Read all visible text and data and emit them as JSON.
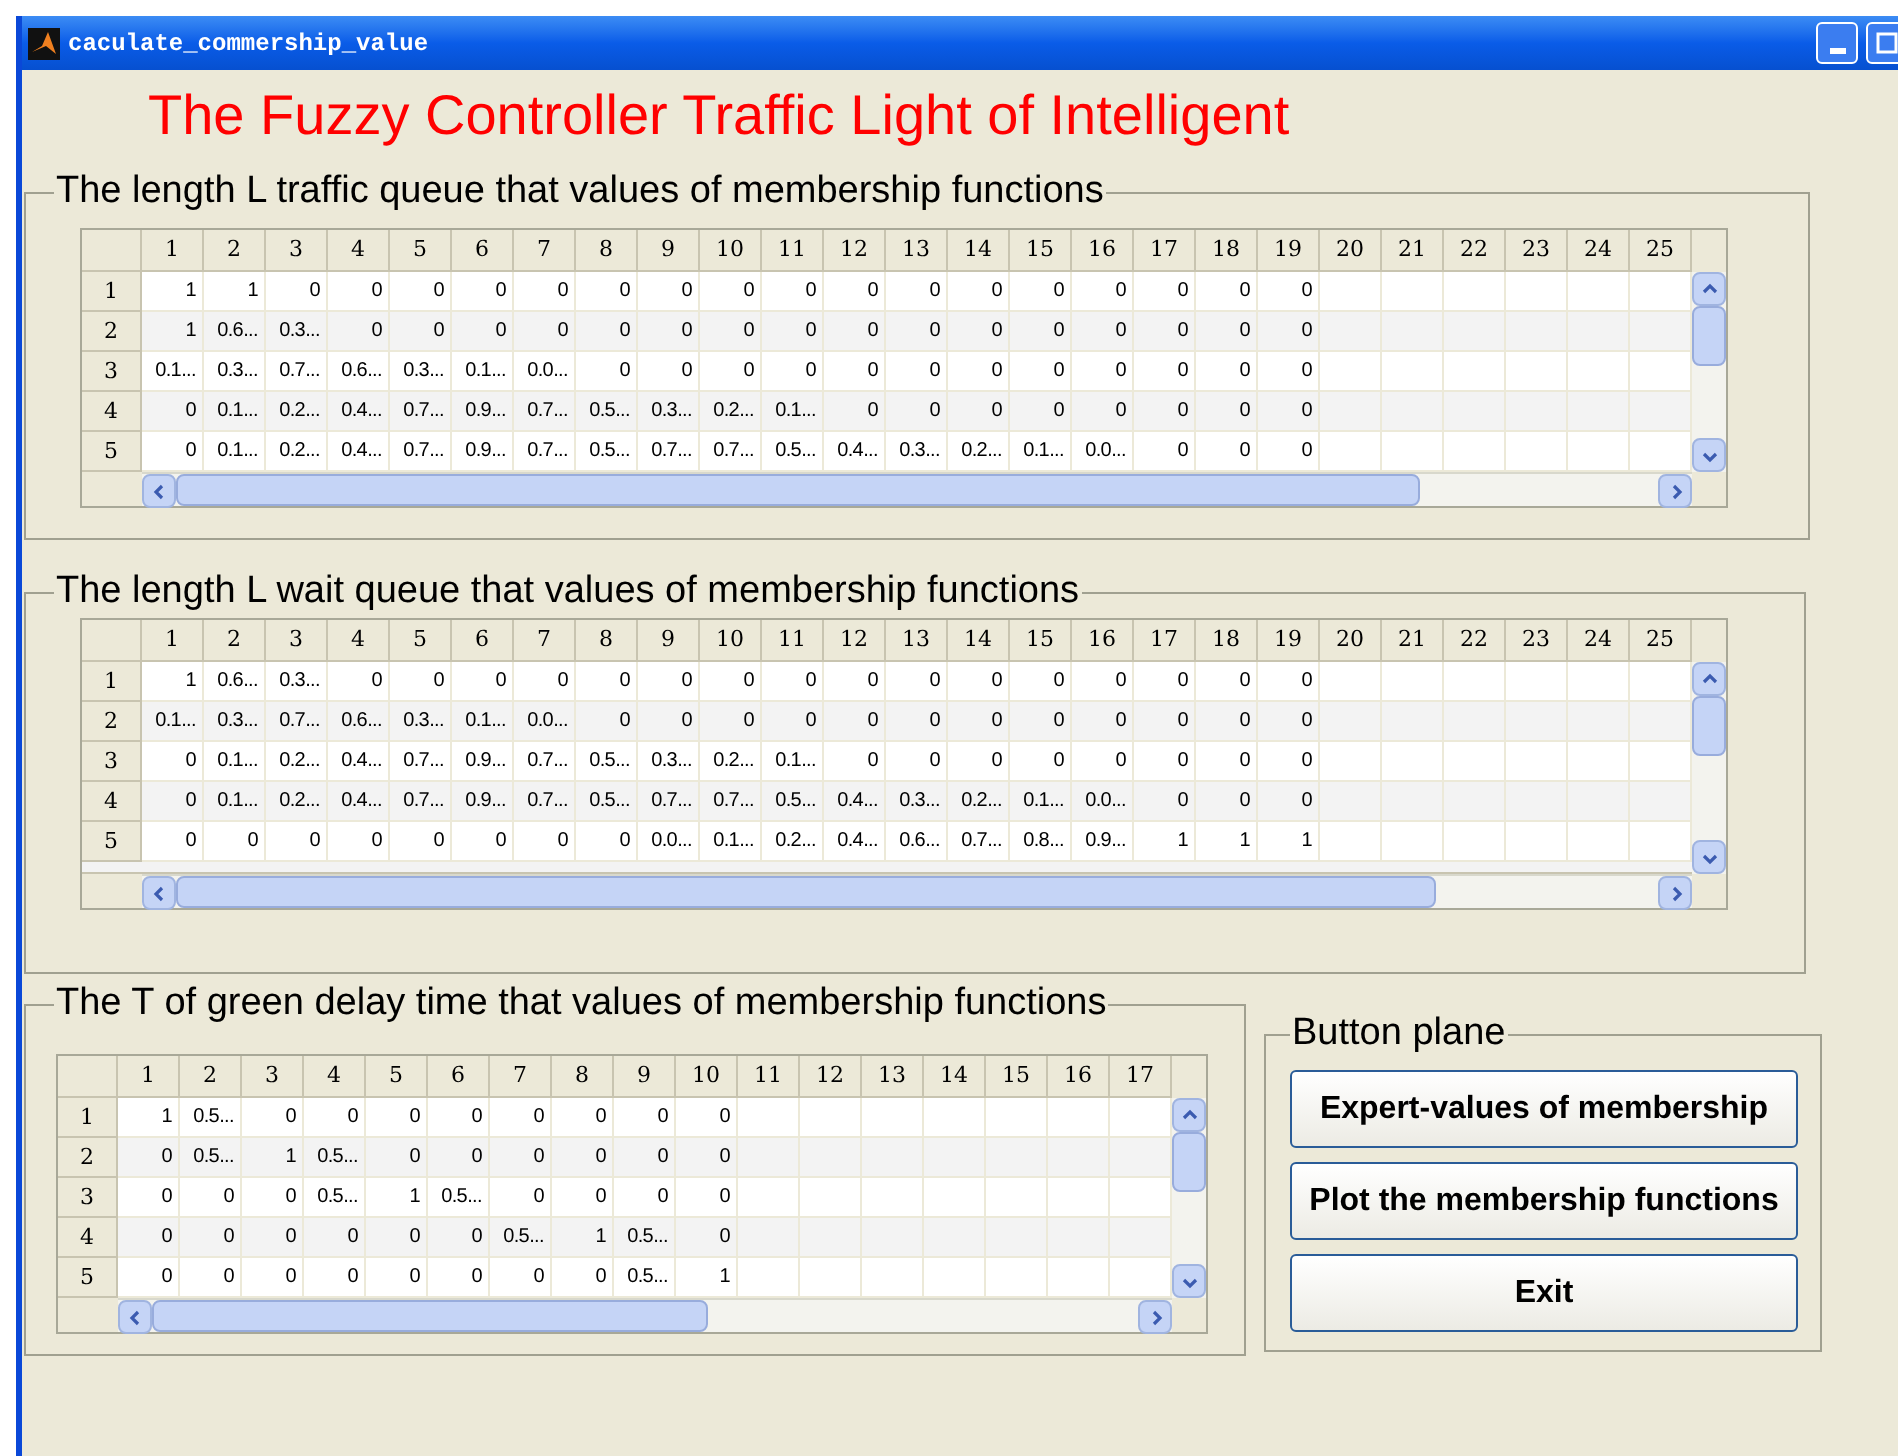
{
  "window": {
    "title": "caculate_commership_value"
  },
  "heading": "The Fuzzy Controller Traffic Light of Intelligent",
  "tables": [
    {
      "title": "The length L traffic queue that values of membership functions",
      "columns": [
        "1",
        "2",
        "3",
        "4",
        "5",
        "6",
        "7",
        "8",
        "9",
        "10",
        "11",
        "12",
        "13",
        "14",
        "15",
        "16",
        "17",
        "18",
        "19",
        "20",
        "21",
        "22",
        "23",
        "24",
        "25"
      ],
      "rows": [
        {
          "label": "1",
          "cells": [
            "1",
            "1",
            "0",
            "0",
            "0",
            "0",
            "0",
            "0",
            "0",
            "0",
            "0",
            "0",
            "0",
            "0",
            "0",
            "0",
            "0",
            "0",
            "0"
          ]
        },
        {
          "label": "2",
          "cells": [
            "1",
            "0.6...",
            "0.3...",
            "0",
            "0",
            "0",
            "0",
            "0",
            "0",
            "0",
            "0",
            "0",
            "0",
            "0",
            "0",
            "0",
            "0",
            "0",
            "0"
          ]
        },
        {
          "label": "3",
          "cells": [
            "0.1...",
            "0.3...",
            "0.7...",
            "0.6...",
            "0.3...",
            "0.1...",
            "0.0...",
            "0",
            "0",
            "0",
            "0",
            "0",
            "0",
            "0",
            "0",
            "0",
            "0",
            "0",
            "0"
          ]
        },
        {
          "label": "4",
          "cells": [
            "0",
            "0.1...",
            "0.2...",
            "0.4...",
            "0.7...",
            "0.9...",
            "0.7...",
            "0.5...",
            "0.3...",
            "0.2...",
            "0.1...",
            "0",
            "0",
            "0",
            "0",
            "0",
            "0",
            "0",
            "0"
          ]
        },
        {
          "label": "5",
          "cells": [
            "0",
            "0.1...",
            "0.2...",
            "0.4...",
            "0.7...",
            "0.9...",
            "0.7...",
            "0.5...",
            "0.7...",
            "0.7...",
            "0.5...",
            "0.4...",
            "0.3...",
            "0.2...",
            "0.1...",
            "0.0...",
            "0",
            "0",
            "0"
          ]
        }
      ]
    },
    {
      "title": "The length L wait queue that values of membership functions",
      "columns": [
        "1",
        "2",
        "3",
        "4",
        "5",
        "6",
        "7",
        "8",
        "9",
        "10",
        "11",
        "12",
        "13",
        "14",
        "15",
        "16",
        "17",
        "18",
        "19",
        "20",
        "21",
        "22",
        "23",
        "24",
        "25"
      ],
      "rows": [
        {
          "label": "1",
          "cells": [
            "1",
            "0.6...",
            "0.3...",
            "0",
            "0",
            "0",
            "0",
            "0",
            "0",
            "0",
            "0",
            "0",
            "0",
            "0",
            "0",
            "0",
            "0",
            "0",
            "0"
          ]
        },
        {
          "label": "2",
          "cells": [
            "0.1...",
            "0.3...",
            "0.7...",
            "0.6...",
            "0.3...",
            "0.1...",
            "0.0...",
            "0",
            "0",
            "0",
            "0",
            "0",
            "0",
            "0",
            "0",
            "0",
            "0",
            "0",
            "0"
          ]
        },
        {
          "label": "3",
          "cells": [
            "0",
            "0.1...",
            "0.2...",
            "0.4...",
            "0.7...",
            "0.9...",
            "0.7...",
            "0.5...",
            "0.3...",
            "0.2...",
            "0.1...",
            "0",
            "0",
            "0",
            "0",
            "0",
            "0",
            "0",
            "0"
          ]
        },
        {
          "label": "4",
          "cells": [
            "0",
            "0.1...",
            "0.2...",
            "0.4...",
            "0.7...",
            "0.9...",
            "0.7...",
            "0.5...",
            "0.7...",
            "0.7...",
            "0.5...",
            "0.4...",
            "0.3...",
            "0.2...",
            "0.1...",
            "0.0...",
            "0",
            "0",
            "0"
          ]
        },
        {
          "label": "5",
          "cells": [
            "0",
            "0",
            "0",
            "0",
            "0",
            "0",
            "0",
            "0",
            "0.0...",
            "0.1...",
            "0.2...",
            "0.4...",
            "0.6...",
            "0.7...",
            "0.8...",
            "0.9...",
            "1",
            "1",
            "1"
          ]
        }
      ]
    },
    {
      "title": "The T of green delay time that values of membership functions",
      "columns": [
        "1",
        "2",
        "3",
        "4",
        "5",
        "6",
        "7",
        "8",
        "9",
        "10",
        "11",
        "12",
        "13",
        "14",
        "15",
        "16",
        "17"
      ],
      "rows": [
        {
          "label": "1",
          "cells": [
            "1",
            "0.5...",
            "0",
            "0",
            "0",
            "0",
            "0",
            "0",
            "0",
            "0"
          ]
        },
        {
          "label": "2",
          "cells": [
            "0",
            "0.5...",
            "1",
            "0.5...",
            "0",
            "0",
            "0",
            "0",
            "0",
            "0"
          ]
        },
        {
          "label": "3",
          "cells": [
            "0",
            "0",
            "0",
            "0.5...",
            "1",
            "0.5...",
            "0",
            "0",
            "0",
            "0"
          ]
        },
        {
          "label": "4",
          "cells": [
            "0",
            "0",
            "0",
            "0",
            "0",
            "0",
            "0.5...",
            "1",
            "0.5...",
            "0"
          ]
        },
        {
          "label": "5",
          "cells": [
            "0",
            "0",
            "0",
            "0",
            "0",
            "0",
            "0",
            "0",
            "0.5...",
            "1"
          ]
        }
      ]
    }
  ],
  "button_panel": {
    "title": "Button plane",
    "buttons": [
      "Expert-values of membership",
      "Plot the membership functions",
      "Exit"
    ]
  }
}
